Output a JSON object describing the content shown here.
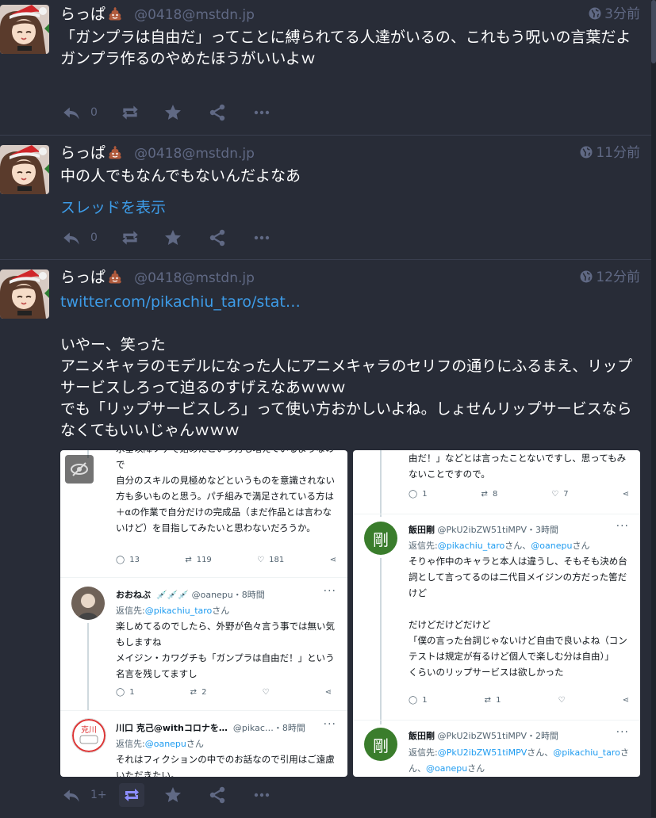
{
  "statuses": [
    {
      "display_name": "らっぱ",
      "acct": "@0418@mstdn.jp",
      "time": "3分前",
      "lines": [
        "「ガンプラは自由だ」ってことに縛られてる人達がいるの、これもう呪いの言葉だよ",
        "ガンプラ作るのやめたほうがいいよｗ"
      ],
      "reply_count": "0"
    },
    {
      "display_name": "らっぱ",
      "acct": "@0418@mstdn.jp",
      "time": "11分前",
      "lines": [
        "中の人でもなんでもないんだよなあ"
      ],
      "thread_link": "スレッドを表示",
      "reply_count": "0"
    },
    {
      "display_name": "らっぱ",
      "acct": "@0418@mstdn.jp",
      "time": "12分前",
      "url": "twitter.com/pikachiu_taro/stat…",
      "lines": [
        "いやー、笑った",
        "アニメキャラのモデルになった人にアニメキャラのセリフの通りにふるまえ、リップサービスしろって迫るのすげえなあｗｗｗ",
        "でも「リップサービスしろ」って使い方おかしいよね。しょせんリップサービスならなくてもいいじゃんｗｗｗ"
      ],
      "reply_count": "1+"
    }
  ],
  "media_left": {
    "top_text_cut": "水垂以降ゾゲで始めたという方も増えているようなので",
    "top_text": [
      "自分のスキルの見極めなどというものを意識されない方も多いものと思う。パチ組みで満足されている方は＋αの作業で自分だけの完成品（まだ作品とは言わないけど）を目指してみたいと思わないだろうか。"
    ],
    "top_counts": {
      "reply": "13",
      "retweet": "119",
      "like": "181"
    },
    "t2": {
      "name": "おおねぶ",
      "name_emoji": "💉💉💉",
      "handle": "@oanepu・8時間",
      "reply_to_label": "返信先:",
      "reply_to": "@pikachiu_taro",
      "reply_suffix": "さん",
      "text": [
        "楽しめてるのでしたら、外野が色々言う事では無い気もしますね",
        "メイジン・カワグチも「ガンプラは自由だ！」という名言を残してますし"
      ],
      "counts": {
        "reply": "1",
        "retweet": "2"
      }
    },
    "t3": {
      "name": "川口 克己@withコロナを…",
      "handle": "@pikac…・8時間",
      "reply_to_label": "返信先:",
      "reply_to": "@oanepu",
      "reply_suffix": "さん",
      "text": [
        "それはフィクションの中でのお話なので引用はご遠慮いただきたい。"
      ],
      "avatar_text": "克川"
    }
  },
  "media_right": {
    "top_text": [
      "由だ！」などとは言ったことないですし、思ってもみないことですので。"
    ],
    "top_counts": {
      "reply": "1",
      "retweet": "8",
      "like": "7"
    },
    "t2": {
      "name": "飯田剛",
      "handle": "@PkU2ibZW51tiMPV・3時間",
      "avatar_char": "剛",
      "reply_to_label": "返信先:",
      "reply_to_a": "@pikachiu_taro",
      "reply_mid": "さん、",
      "reply_to_b": "@oanepu",
      "reply_suffix": "さん",
      "text": [
        "そりゃ作中のキャラと本人は違うし、そもそも決め台詞として言ってるのは二代目メイジンの方だった筈だけど",
        "",
        "だけどだけどだけど",
        "「僕の言った台詞じゃないけど自由で良いよね（コンテストは規定が有るけど個人で楽しむ分は自由）」",
        "くらいのリップサービスは欲しかった"
      ],
      "counts": {
        "reply": "1",
        "retweet": "1"
      }
    },
    "t3": {
      "name": "飯田剛",
      "handle": "@PkU2ibZW51tiMPV・2時間",
      "avatar_char": "剛",
      "reply_to_label": "返信先:",
      "reply_line1": "@PkU2ibZW51tiMPV",
      "reply_mid": "さん、",
      "reply_line2": "@pikachiu_taro",
      "reply_line3": "さん、",
      "reply_line4": "@oanepu",
      "reply_suffix": "さん"
    }
  },
  "icons": {
    "reply": "reply-icon",
    "boost": "boost-icon",
    "favourite": "star-icon",
    "share": "share-icon",
    "more": "ellipsis-icon",
    "visibility": "globe-icon"
  },
  "colors": {
    "background": "#282c37",
    "link": "#3d9ce8",
    "muted": "#606984",
    "boost_active_bg": "#313543"
  }
}
